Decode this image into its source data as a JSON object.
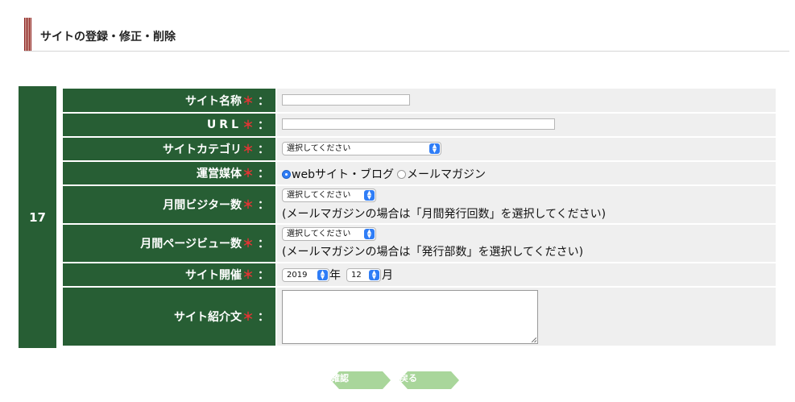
{
  "header": {
    "title": "サイトの登録・修正・削除"
  },
  "entry": {
    "number": "17"
  },
  "required_mark": "＊",
  "colon": "：",
  "fields": {
    "site_name": {
      "label": "サイト名称",
      "value": ""
    },
    "url": {
      "label": "URL",
      "value": ""
    },
    "category": {
      "label": "サイトカテゴリ",
      "selected": "選択してください"
    },
    "media": {
      "label": "運営媒体",
      "options": [
        "webサイト・ブログ",
        "メールマガジン"
      ],
      "selected_index": 0
    },
    "monthly_visitors": {
      "label": "月間ビジター数",
      "selected": "選択してください",
      "note": "(メールマガジンの場合は「月間発行回数」を選択してください)"
    },
    "monthly_pageviews": {
      "label": "月間ページビュー数",
      "selected": "選択してください",
      "note": "(メールマガジンの場合は「発行部数」を選択してください)"
    },
    "opened": {
      "label": "サイト開催",
      "year": "2019",
      "year_suffix": "年",
      "month": "12",
      "month_suffix": "月"
    },
    "description": {
      "label": "サイト紹介文",
      "value": ""
    }
  },
  "buttons": {
    "confirm": "確認",
    "back": "戻る"
  },
  "colors": {
    "label_bg": "#275e34",
    "field_bg": "#efefef",
    "required": "#e33434",
    "select_arrow": "#2f7df6"
  }
}
